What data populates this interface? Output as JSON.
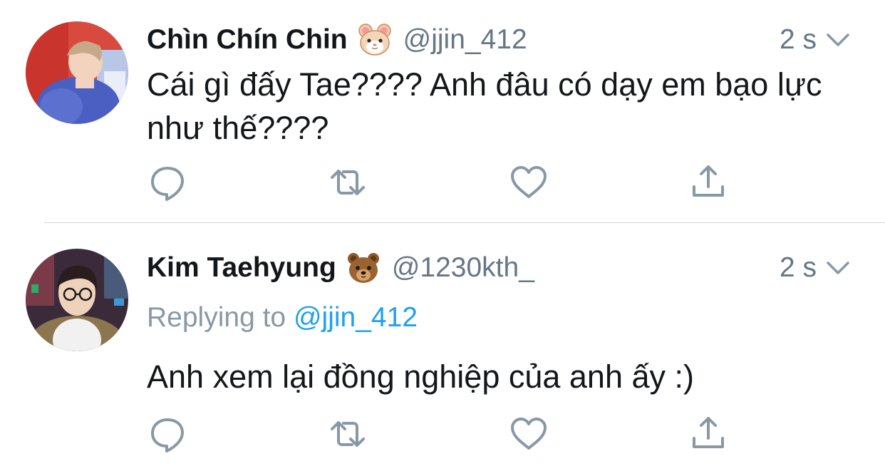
{
  "tweets": [
    {
      "display_name": "Chìn Chín Chin",
      "name_emoji": "hamster-face",
      "handle": "@jjin_412",
      "time": "2 s",
      "text": "Cái gì đấy Tae???? Anh đâu có dạy em bạo lực như thế????",
      "actions": [
        "reply-icon",
        "retweet-icon",
        "like-icon",
        "share-icon"
      ]
    },
    {
      "display_name": "Kim Taehyung",
      "name_emoji": "bear-face",
      "handle": "@1230kth_",
      "time": "2 s",
      "replying_prefix": "Replying to",
      "replying_mention": "@jjin_412",
      "text": "Anh xem lại đồng nghiệp của anh ấy :)",
      "actions": [
        "reply-icon",
        "retweet-icon",
        "like-icon",
        "share-icon"
      ]
    }
  ],
  "colors": {
    "text_primary": "#14171a",
    "text_secondary": "#657786",
    "icon_gray": "#8899a6",
    "link_blue": "#1da1f2",
    "divider": "#d6d6d6"
  }
}
